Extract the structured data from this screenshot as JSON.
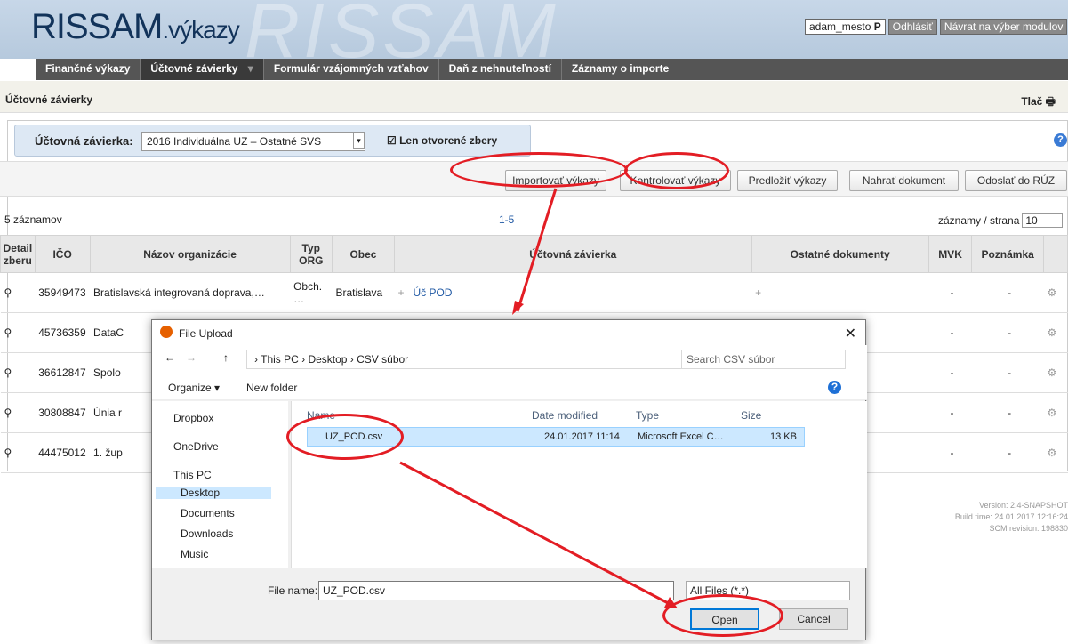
{
  "header": {
    "logo": "RISSAM",
    "logo_sub": ".výkazy",
    "logo_bg": "RISSAM",
    "user": "adam_mesto",
    "user_flag": "P",
    "logout": "Odhlásiť",
    "back": "Návrat na výber modulov"
  },
  "nav": [
    "Finančné výkazy",
    "Účtovné závierky",
    "Formulár vzájomných vzťahov",
    "Daň z nehnuteľností",
    "Záznamy o importe"
  ],
  "breadcrumb": "Účtovné závierky",
  "print": "Tlač",
  "filter": {
    "label": "Účtovná závierka:",
    "value": "2016 Individuálna UZ – Ostatné SVS",
    "checkbox": "Len otvorené zbery"
  },
  "buttons": [
    "Importovať výkazy",
    "Kontrolovať výkazy",
    "Predložiť výkazy",
    "Nahrať dokument",
    "Odoslať do RÚZ"
  ],
  "count": "5 záznamov",
  "pages": "1-5",
  "per_page_label": "záznamy / strana",
  "per_page": "10",
  "columns": [
    "Detail zberu",
    "IČO",
    "Názov organizácie",
    "Typ ORG",
    "Obec",
    "Účtovná závierka",
    "Ostatné dokumenty",
    "MVK",
    "Poznámka"
  ],
  "rows": [
    {
      "ico": "35949473",
      "name": "Bratislavská integrovaná doprava,…",
      "typ": "Obch. …",
      "obec": "Bratislava",
      "uz": "Úč POD",
      "mvk": "-",
      "pozn": "-"
    },
    {
      "ico": "45736359",
      "name": "DataC",
      "mvk": "-",
      "pozn": "-"
    },
    {
      "ico": "36612847",
      "name": "Spolo",
      "mvk": "-",
      "pozn": "-"
    },
    {
      "ico": "30808847",
      "name": "Únia r",
      "mvk": "-",
      "pozn": "-"
    },
    {
      "ico": "44475012",
      "name": "1. žup",
      "mvk": "-",
      "pozn": "-"
    }
  ],
  "version": [
    "Version: 2.4-SNAPSHOT",
    "Build time: 24.01.2017 12:16:24",
    "SCM revision: 198830"
  ],
  "dialog": {
    "title": "File Upload",
    "path": "› This PC › Desktop › CSV súbor",
    "search": "Search CSV súbor",
    "organize": "Organize ▾",
    "new_folder": "New folder",
    "nav": [
      "Dropbox",
      "OneDrive",
      "This PC",
      "Desktop",
      "Documents",
      "Downloads",
      "Music"
    ],
    "cols": [
      "Name",
      "Date modified",
      "Type",
      "Size"
    ],
    "file": {
      "name": "UZ_POD.csv",
      "date": "24.01.2017 11:14",
      "type": "Microsoft Excel C…",
      "size": "13 KB"
    },
    "file_name_label": "File name:",
    "file_name": "UZ_POD.csv",
    "file_type": "All Files (*.*)",
    "open": "Open",
    "cancel": "Cancel"
  }
}
